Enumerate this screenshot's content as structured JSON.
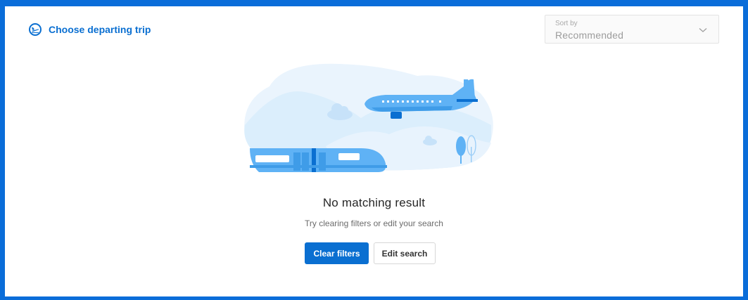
{
  "header": {
    "title": "Choose departing trip",
    "icon": "plane-departure-icon",
    "accent_color": "#0a6fd1"
  },
  "sort": {
    "label": "Sort by",
    "value": "Recommended",
    "icon": "chevron-down-icon"
  },
  "empty_state": {
    "illustration": "plane-and-train-illustration",
    "title": "No matching result",
    "subtitle": "Try clearing filters or edit your search"
  },
  "actions": {
    "clear_filters_label": "Clear filters",
    "edit_search_label": "Edit search"
  },
  "colors": {
    "frame_border": "#0a6dd9",
    "primary_button": "#0a6fd1",
    "illustration_light": "#eaf4fd",
    "illustration_blue": "#5fb2f5"
  }
}
